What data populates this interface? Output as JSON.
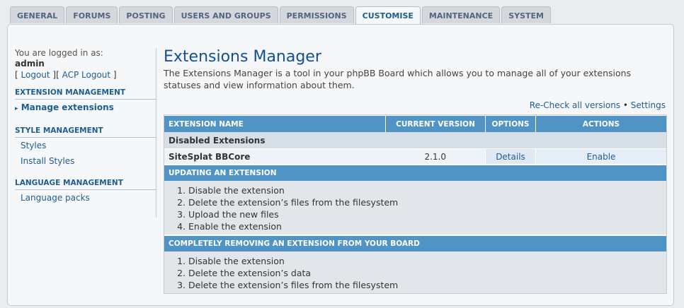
{
  "tabs": [
    {
      "label": "GENERAL"
    },
    {
      "label": "FORUMS"
    },
    {
      "label": "POSTING"
    },
    {
      "label": "USERS AND GROUPS"
    },
    {
      "label": "PERMISSIONS"
    },
    {
      "label": "CUSTOMISE",
      "active": true
    },
    {
      "label": "MAINTENANCE"
    },
    {
      "label": "SYSTEM"
    }
  ],
  "sidebar": {
    "logged_in_text": "You are logged in as:",
    "username": "admin",
    "logout_link": "Logout",
    "acp_logout_link": "ACP Logout",
    "groups": [
      {
        "heading": "EXTENSION MANAGEMENT",
        "items": [
          {
            "label": "Manage extensions",
            "active": true
          }
        ]
      },
      {
        "heading": "STYLE MANAGEMENT",
        "items": [
          {
            "label": "Styles"
          },
          {
            "label": "Install Styles"
          }
        ]
      },
      {
        "heading": "LANGUAGE MANAGEMENT",
        "items": [
          {
            "label": "Language packs"
          }
        ]
      }
    ]
  },
  "main": {
    "title": "Extensions Manager",
    "description": "The Extensions Manager is a tool in your phpBB Board which allows you to manage all of your extensions statuses and view information about them.",
    "recheck_link": "Re-Check all versions",
    "settings_link": "Settings",
    "table": {
      "headers": [
        "EXTENSION NAME",
        "CURRENT VERSION",
        "OPTIONS",
        "ACTIONS"
      ],
      "group_label": "Disabled Extensions",
      "rows": [
        {
          "name": "SiteSplat BBCore",
          "version": "2.1.0",
          "option": "Details",
          "action": "Enable"
        }
      ]
    },
    "updating": {
      "heading": "UPDATING AN EXTENSION",
      "steps": [
        "Disable the extension",
        "Delete the extension’s files from the filesystem",
        "Upload the new files",
        "Enable the extension"
      ]
    },
    "removing": {
      "heading": "COMPLETELY REMOVING AN EXTENSION FROM YOUR BOARD",
      "steps": [
        "Disable the extension",
        "Delete the extension’s data",
        "Delete the extension’s files from the filesystem"
      ]
    }
  }
}
